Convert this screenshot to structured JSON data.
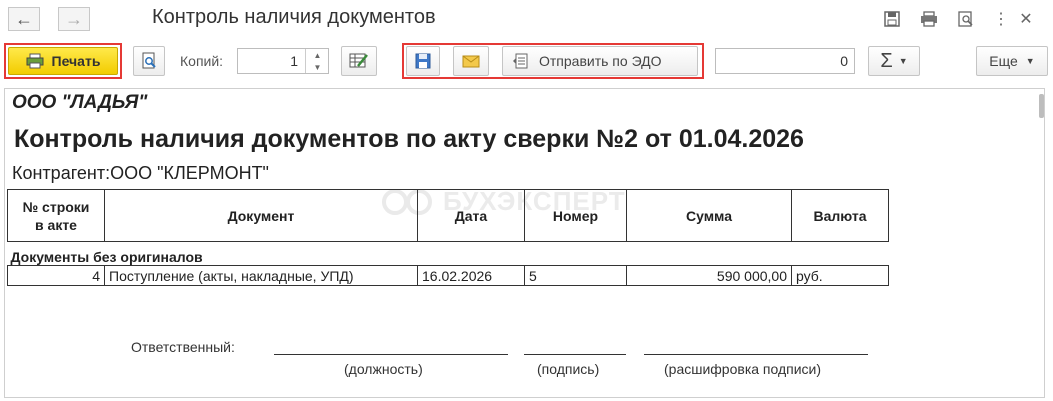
{
  "window": {
    "title": "Контроль наличия документов",
    "back_icon": "arrow-left-icon",
    "forward_icon": "arrow-right-icon"
  },
  "toolbar": {
    "print_label": "Печать",
    "copies_label": "Копий:",
    "copies_value": "1",
    "send_edo_label": "Отправить по ЭДО",
    "sum_value": "0",
    "more_label": "Еще"
  },
  "document": {
    "org": "ООО \"ЛАДЬЯ\"",
    "heading": "Контроль наличия документов по акту сверки №2 от 01.04.2026",
    "counterparty": "Контрагент:ООО \"КЛЕРМОНТ\"",
    "watermark": "БУХЭКСПЕРТ",
    "table": {
      "headers": {
        "row_no_line1": "№ строки",
        "row_no_line2": "в акте",
        "document": "Документ",
        "date": "Дата",
        "number": "Номер",
        "amount": "Сумма",
        "currency": "Валюта"
      },
      "section": "Документы без оригиналов",
      "rows": [
        {
          "row_no": "4",
          "document": "Поступление (акты, накладные, УПД)",
          "date": "16.02.2026",
          "number": "5",
          "amount": "590 000,00",
          "currency": "руб."
        }
      ]
    },
    "signature": {
      "responsible_label": "Ответственный:",
      "position_caption": "(должность)",
      "signature_caption": "(подпись)",
      "decoding_caption": "(расшифровка подписи)"
    }
  },
  "colors": {
    "print_yellow": "#f5d90a",
    "highlight_red": "#e53935",
    "watermark": "#eaeaea"
  }
}
